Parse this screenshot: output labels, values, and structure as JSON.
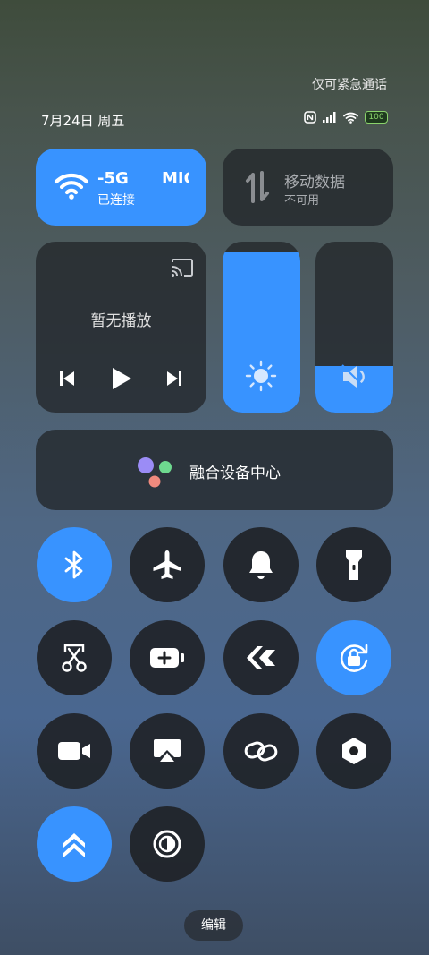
{
  "status": {
    "emergency_text": "仅可紧急通话",
    "date_text": "7月24日 周五",
    "battery": "100"
  },
  "wifi": {
    "ssid": "-5G",
    "ssid_right": "MIC",
    "state": "已连接"
  },
  "mobile_data": {
    "title": "移动数据",
    "state": "不可用"
  },
  "media": {
    "status": "暂无播放"
  },
  "sliders": {
    "brightness_level": 0.94,
    "volume_level": 0.27
  },
  "fusion": {
    "label": "融合设备中心"
  },
  "toggles": [
    {
      "name": "bluetooth",
      "icon": "bluetooth-icon",
      "on": true
    },
    {
      "name": "airplane",
      "icon": "airplane-icon",
      "on": false
    },
    {
      "name": "bell",
      "icon": "bell-icon",
      "on": false
    },
    {
      "name": "flashlight",
      "icon": "flashlight-icon",
      "on": false
    },
    {
      "name": "screenshot",
      "icon": "scissors-icon",
      "on": false
    },
    {
      "name": "battery-saver",
      "icon": "battery-plus-icon",
      "on": false
    },
    {
      "name": "nearby-share",
      "icon": "share-icon",
      "on": false
    },
    {
      "name": "rotation-lock",
      "icon": "rotation-lock-icon",
      "on": true
    },
    {
      "name": "screen-record",
      "icon": "video-camera-icon",
      "on": false
    },
    {
      "name": "cast",
      "icon": "cast-screen-icon",
      "on": false
    },
    {
      "name": "link",
      "icon": "link-icon",
      "on": false
    },
    {
      "name": "settings",
      "icon": "hex-nut-icon",
      "on": false
    },
    {
      "name": "boost",
      "icon": "double-chevron-up-icon",
      "on": true
    },
    {
      "name": "dark-mode",
      "icon": "contrast-icon",
      "on": false
    }
  ],
  "edit_label": "编辑",
  "colors": {
    "accent": "#3893ff",
    "tile": "#23262a"
  }
}
